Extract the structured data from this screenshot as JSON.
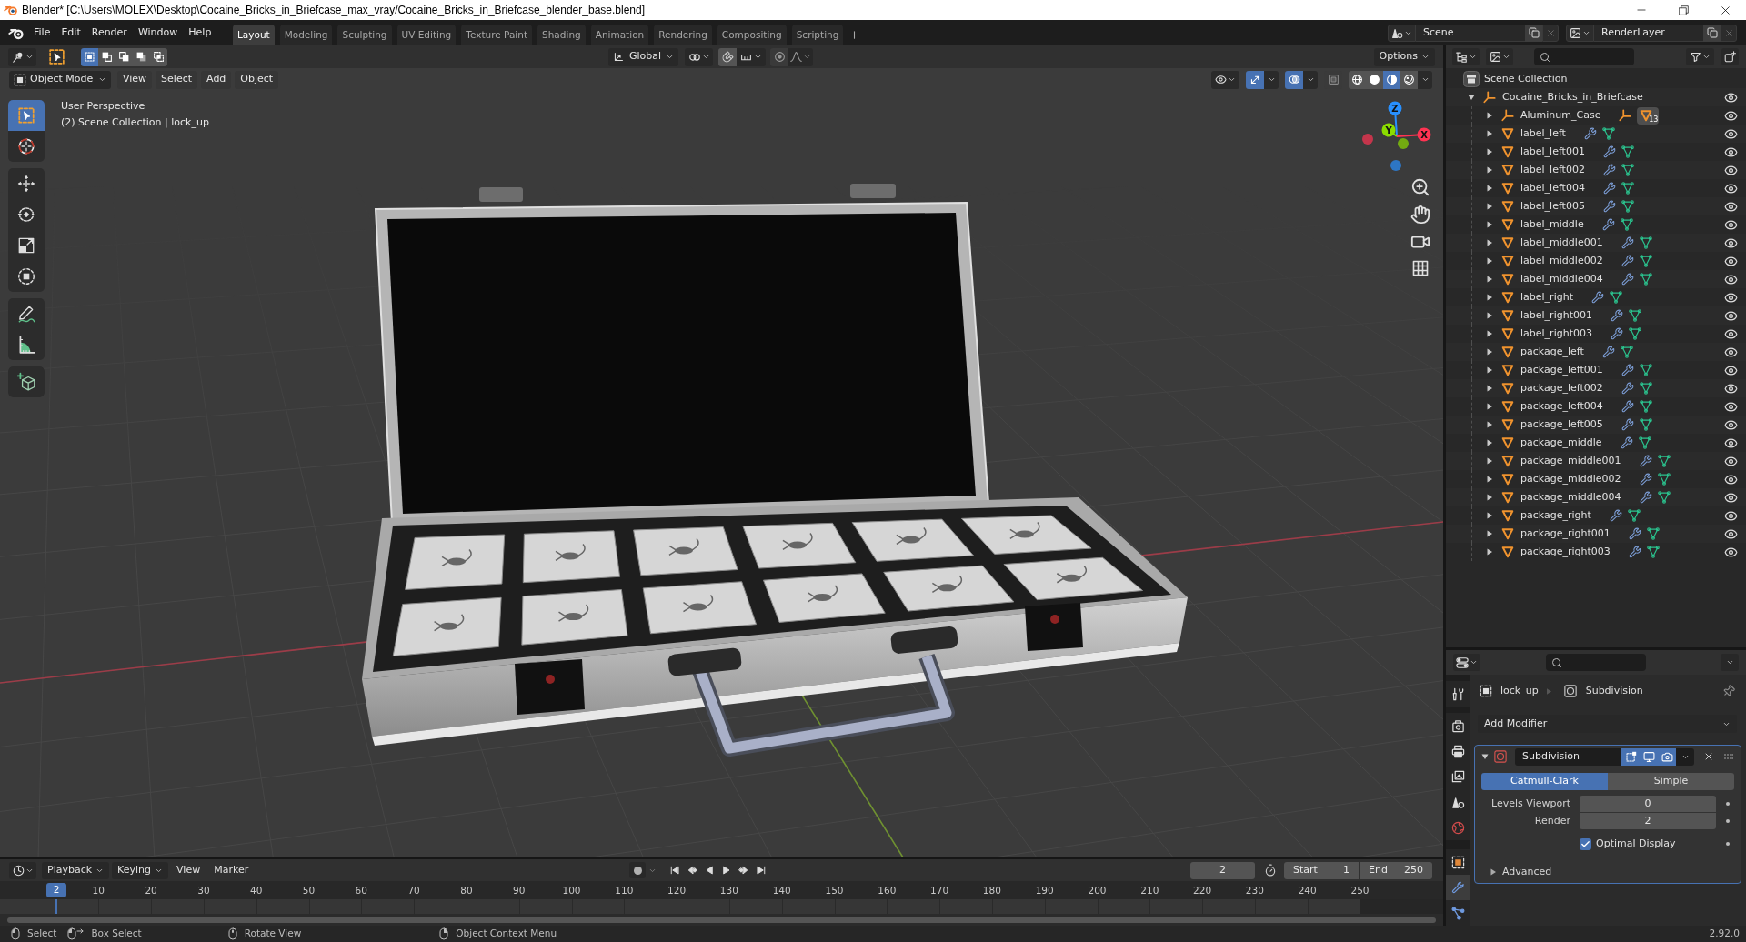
{
  "window": {
    "title": "Blender* [C:\\Users\\MOLEX\\Desktop\\Cocaine_Bricks_in_Briefcase_max_vray/Cocaine_Bricks_in_Briefcase_blender_base.blend]"
  },
  "menu_bar": [
    "File",
    "Edit",
    "Render",
    "Window",
    "Help"
  ],
  "workspace_tabs": [
    {
      "label": "Layout",
      "selected": true
    },
    {
      "label": "Modeling",
      "selected": false
    },
    {
      "label": "Sculpting",
      "selected": false
    },
    {
      "label": "UV Editing",
      "selected": false
    },
    {
      "label": "Texture Paint",
      "selected": false
    },
    {
      "label": "Shading",
      "selected": false
    },
    {
      "label": "Animation",
      "selected": false
    },
    {
      "label": "Rendering",
      "selected": false
    },
    {
      "label": "Compositing",
      "selected": false
    },
    {
      "label": "Scripting",
      "selected": false
    }
  ],
  "scene": "Scene",
  "view_layer": "RenderLayer",
  "tool_header": {
    "select_modes": [
      {
        "kind": "set",
        "selected": true
      },
      {
        "kind": "extend",
        "selected": false
      },
      {
        "kind": "subtract",
        "selected": false
      },
      {
        "kind": "difference",
        "selected": false
      },
      {
        "kind": "intersect",
        "selected": false
      }
    ],
    "orientation": "Global",
    "snap_on": false,
    "proportional_on": false,
    "options": "Options"
  },
  "viewport_header": {
    "mode": "Object Mode",
    "menus": [
      "View",
      "Select",
      "Add",
      "Object"
    ],
    "toggles": [
      {
        "kind": "gizmos",
        "on": true
      },
      {
        "kind": "overlays",
        "on": true
      },
      {
        "kind": "xray",
        "on": false
      }
    ],
    "shading": [
      {
        "kind": "wireframe",
        "selected": false
      },
      {
        "kind": "solid",
        "selected": false
      },
      {
        "kind": "material",
        "selected": true
      },
      {
        "kind": "rendered",
        "selected": false
      }
    ]
  },
  "toolbar": [
    {
      "tools": [
        {
          "kind": "select_box",
          "selected": true
        },
        {
          "kind": "cursor",
          "selected": false
        }
      ]
    },
    {
      "tools": [
        {
          "kind": "move",
          "selected": false
        },
        {
          "kind": "rotate",
          "selected": false
        },
        {
          "kind": "scale",
          "selected": false
        },
        {
          "kind": "transform",
          "selected": false
        }
      ]
    },
    {
      "tools": [
        {
          "kind": "annotate",
          "selected": false
        },
        {
          "kind": "measure",
          "selected": false
        }
      ]
    },
    {
      "tools": [
        {
          "kind": "add_cube",
          "selected": false
        }
      ]
    }
  ],
  "viewport": {
    "view_name": "User Perspective",
    "info": "(2) Scene Collection | lock_up",
    "axes": [
      {
        "label": "Z",
        "color": "#2890ff"
      },
      {
        "label": "Y",
        "color": "#8bdc00"
      },
      {
        "label": "X",
        "color": "#ff3352"
      }
    ]
  },
  "outliner": {
    "root": "Scene Collection",
    "items": [
      {
        "name": "Cocaine_Bricks_in_Briefcase",
        "kind": "empty",
        "expanded": true,
        "visible": true,
        "children": [
          {
            "name": "Aluminum_Case",
            "kind": "empty",
            "expanded": false,
            "visible": true,
            "inline": [
              {
                "kind": "empty"
              },
              {
                "kind": "mesh",
                "count": "13"
              }
            ]
          },
          {
            "name": "label_left",
            "kind": "mesh",
            "expanded": false,
            "visible": true,
            "inline": [
              {
                "kind": "modifiers"
              },
              {
                "kind": "mesh_data"
              }
            ]
          },
          {
            "name": "label_left001",
            "kind": "mesh",
            "expanded": false,
            "visible": true,
            "inline": [
              {
                "kind": "modifiers"
              },
              {
                "kind": "mesh_data"
              }
            ]
          },
          {
            "name": "label_left002",
            "kind": "mesh",
            "expanded": false,
            "visible": true,
            "inline": [
              {
                "kind": "modifiers"
              },
              {
                "kind": "mesh_data"
              }
            ]
          },
          {
            "name": "label_left004",
            "kind": "mesh",
            "expanded": false,
            "visible": true,
            "inline": [
              {
                "kind": "modifiers"
              },
              {
                "kind": "mesh_data"
              }
            ]
          },
          {
            "name": "label_left005",
            "kind": "mesh",
            "expanded": false,
            "visible": true,
            "inline": [
              {
                "kind": "modifiers"
              },
              {
                "kind": "mesh_data"
              }
            ]
          },
          {
            "name": "label_middle",
            "kind": "mesh",
            "expanded": false,
            "visible": true,
            "inline": [
              {
                "kind": "modifiers"
              },
              {
                "kind": "mesh_data"
              }
            ]
          },
          {
            "name": "label_middle001",
            "kind": "mesh",
            "expanded": false,
            "visible": true,
            "inline": [
              {
                "kind": "modifiers"
              },
              {
                "kind": "mesh_data"
              }
            ]
          },
          {
            "name": "label_middle002",
            "kind": "mesh",
            "expanded": false,
            "visible": true,
            "inline": [
              {
                "kind": "modifiers"
              },
              {
                "kind": "mesh_data"
              }
            ]
          },
          {
            "name": "label_middle004",
            "kind": "mesh",
            "expanded": false,
            "visible": true,
            "inline": [
              {
                "kind": "modifiers"
              },
              {
                "kind": "mesh_data"
              }
            ]
          },
          {
            "name": "label_right",
            "kind": "mesh",
            "expanded": false,
            "visible": true,
            "inline": [
              {
                "kind": "modifiers"
              },
              {
                "kind": "mesh_data"
              }
            ]
          },
          {
            "name": "label_right001",
            "kind": "mesh",
            "expanded": false,
            "visible": true,
            "inline": [
              {
                "kind": "modifiers"
              },
              {
                "kind": "mesh_data"
              }
            ]
          },
          {
            "name": "label_right003",
            "kind": "mesh",
            "expanded": false,
            "visible": true,
            "inline": [
              {
                "kind": "modifiers"
              },
              {
                "kind": "mesh_data"
              }
            ]
          },
          {
            "name": "package_left",
            "kind": "mesh",
            "expanded": false,
            "visible": true,
            "inline": [
              {
                "kind": "modifiers"
              },
              {
                "kind": "mesh_data"
              }
            ]
          },
          {
            "name": "package_left001",
            "kind": "mesh",
            "expanded": false,
            "visible": true,
            "inline": [
              {
                "kind": "modifiers"
              },
              {
                "kind": "mesh_data"
              }
            ]
          },
          {
            "name": "package_left002",
            "kind": "mesh",
            "expanded": false,
            "visible": true,
            "inline": [
              {
                "kind": "modifiers"
              },
              {
                "kind": "mesh_data"
              }
            ]
          },
          {
            "name": "package_left004",
            "kind": "mesh",
            "expanded": false,
            "visible": true,
            "inline": [
              {
                "kind": "modifiers"
              },
              {
                "kind": "mesh_data"
              }
            ]
          },
          {
            "name": "package_left005",
            "kind": "mesh",
            "expanded": false,
            "visible": true,
            "inline": [
              {
                "kind": "modifiers"
              },
              {
                "kind": "mesh_data"
              }
            ]
          },
          {
            "name": "package_middle",
            "kind": "mesh",
            "expanded": false,
            "visible": true,
            "inline": [
              {
                "kind": "modifiers"
              },
              {
                "kind": "mesh_data"
              }
            ]
          },
          {
            "name": "package_middle001",
            "kind": "mesh",
            "expanded": false,
            "visible": true,
            "inline": [
              {
                "kind": "modifiers"
              },
              {
                "kind": "mesh_data"
              }
            ]
          },
          {
            "name": "package_middle002",
            "kind": "mesh",
            "expanded": false,
            "visible": true,
            "inline": [
              {
                "kind": "modifiers"
              },
              {
                "kind": "mesh_data"
              }
            ]
          },
          {
            "name": "package_middle004",
            "kind": "mesh",
            "expanded": false,
            "visible": true,
            "inline": [
              {
                "kind": "modifiers"
              },
              {
                "kind": "mesh_data"
              }
            ]
          },
          {
            "name": "package_right",
            "kind": "mesh",
            "expanded": false,
            "visible": true,
            "inline": [
              {
                "kind": "modifiers"
              },
              {
                "kind": "mesh_data"
              }
            ]
          },
          {
            "name": "package_right001",
            "kind": "mesh",
            "expanded": false,
            "visible": true,
            "inline": [
              {
                "kind": "modifiers"
              },
              {
                "kind": "mesh_data"
              }
            ]
          },
          {
            "name": "package_right003",
            "kind": "mesh",
            "expanded": false,
            "visible": true,
            "inline": [
              {
                "kind": "modifiers"
              },
              {
                "kind": "mesh_data"
              }
            ]
          }
        ]
      }
    ]
  },
  "properties": {
    "tabs": [
      {
        "kind": "tool",
        "selected": false
      },
      {
        "kind": "render",
        "selected": false
      },
      {
        "kind": "output",
        "selected": false
      },
      {
        "kind": "view_layer",
        "selected": false
      },
      {
        "kind": "scene",
        "selected": false
      },
      {
        "kind": "world",
        "selected": false
      },
      {
        "kind": "object",
        "selected": false
      },
      {
        "kind": "modifiers",
        "selected": true
      },
      {
        "kind": "particles",
        "selected": false
      }
    ],
    "breadcrumb": {
      "object": "lock_up",
      "modifier": "Subdivision"
    },
    "add_modifier": "Add Modifier",
    "modifier": {
      "name": "Subdivision",
      "expanded": true,
      "edit_mode": true,
      "show_viewport": true,
      "show_render": true,
      "types": [
        {
          "label": "Catmull-Clark",
          "selected": true
        },
        {
          "label": "Simple",
          "selected": false
        }
      ],
      "fields": [
        {
          "label": "Levels Viewport",
          "value": "0"
        },
        {
          "label": "Render",
          "value": "2"
        }
      ],
      "optimal_display": {
        "label": "Optimal Display",
        "checked": true
      },
      "advanced": {
        "label": "Advanced",
        "expanded": false
      }
    }
  },
  "timeline": {
    "menus": [
      {
        "label": "Playback",
        "kind": "dropdown"
      },
      {
        "label": "Keying",
        "kind": "dropdown"
      },
      {
        "label": "View",
        "kind": "menu"
      },
      {
        "label": "Marker",
        "kind": "menu"
      }
    ],
    "auto_keying": false,
    "current_frame": "2",
    "start": {
      "label": "Start",
      "value": "1"
    },
    "end": {
      "label": "End",
      "value": "250"
    },
    "playhead": "2",
    "ruler": [
      "10",
      "20",
      "30",
      "40",
      "50",
      "60",
      "70",
      "80",
      "90",
      "100",
      "110",
      "120",
      "130",
      "140",
      "150",
      "160",
      "170",
      "180",
      "190",
      "200",
      "210",
      "220",
      "230",
      "240",
      "250"
    ]
  },
  "status_bar": {
    "hints": [
      {
        "kind": "left_click",
        "label": "Select"
      },
      {
        "kind": "left_drag",
        "label": "Box Select"
      },
      {
        "kind": "middle_drag",
        "label": "Rotate View"
      },
      {
        "kind": "right_click",
        "label": "Object Context Menu"
      }
    ],
    "version": "2.92.0"
  }
}
